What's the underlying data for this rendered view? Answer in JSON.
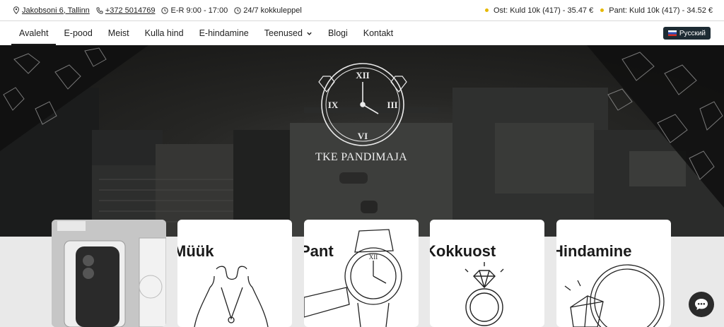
{
  "topbar": {
    "address": "Jakobsoni 6, Tallinn",
    "phone": "+372 5014769",
    "hours": "E-R 9:00 - 17:00",
    "appointment": "24/7 kokkuleppel",
    "buy_rate": "Ost: Kuld 10k (417) - 35.47 €",
    "pawn_rate": "Pant: Kuld 10k (417) - 34.52 €",
    "icons": {
      "address": "location-pin-icon",
      "hours": "clock-icon",
      "appointment": "clock-icon"
    },
    "rate_dot_color": "#e6b800"
  },
  "nav": {
    "items": [
      {
        "label": "Avaleht",
        "active": true
      },
      {
        "label": "E-pood"
      },
      {
        "label": "Meist"
      },
      {
        "label": "Kulla hind"
      },
      {
        "label": "E-hindamine"
      },
      {
        "label": "Teenused",
        "has_dropdown": true
      },
      {
        "label": "Blogi"
      },
      {
        "label": "Kontakt"
      }
    ],
    "language_button": "Русский"
  },
  "hero": {
    "logo_text": "TKE PANDIMAJA",
    "clock_numerals": [
      "XII",
      "III",
      "VI",
      "IX"
    ]
  },
  "cards": [
    {
      "title": ""
    },
    {
      "title": "Müük"
    },
    {
      "title": "Pant"
    },
    {
      "title": "Kokkuost"
    },
    {
      "title": "Hindamine"
    }
  ],
  "chat": {
    "icon": "chat-bubble-icon"
  }
}
